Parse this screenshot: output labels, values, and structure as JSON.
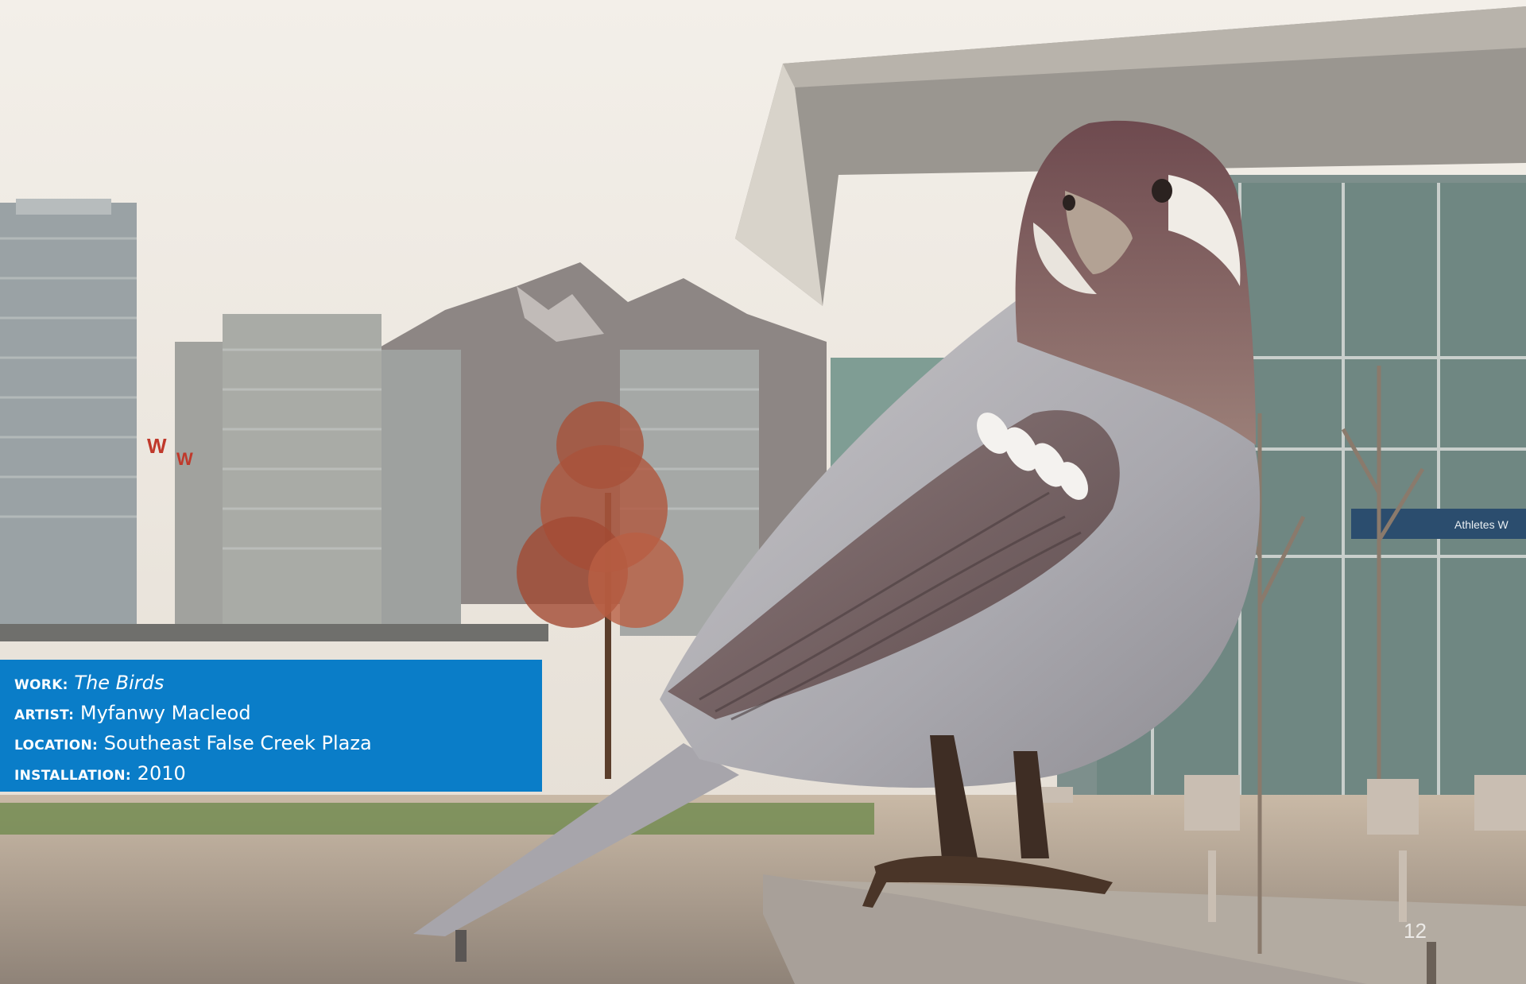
{
  "caption": {
    "work_label": "WORK:",
    "work_value": "The Birds",
    "artist_label": "ARTIST:",
    "artist_value": "Myfanwy Macleod",
    "location_label": "LOCATION:",
    "location_value": "Southeast False Creek Plaza",
    "installation_label": "INSTALLATION:",
    "installation_value": "2010"
  },
  "photo": {
    "building_sign": "Athletes W"
  },
  "page_number": "12",
  "colors": {
    "caption_background": "#0a7dc8",
    "caption_text": "#ffffff"
  }
}
